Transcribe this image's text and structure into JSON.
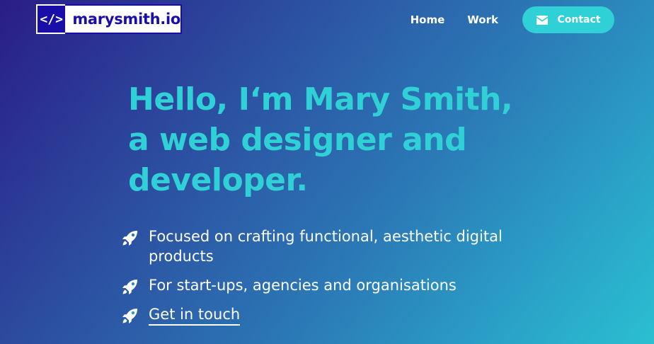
{
  "header": {
    "logo": {
      "code_glyph": "</>",
      "name": "marysmith.io"
    },
    "nav": {
      "home_label": "Home",
      "work_label": "Work",
      "contact_label": "Contact",
      "contact_icon": "envelope-icon"
    }
  },
  "hero": {
    "title": "Hello, I‘m Mary Smith, a web designer and developer."
  },
  "features": {
    "icon": "rocket-icon",
    "items": [
      {
        "label": "Focused on crafting functional, aesthetic digital products"
      },
      {
        "label": "For start-ups, agencies and organisations"
      },
      {
        "label": "Get in touch"
      }
    ]
  },
  "colors": {
    "accent": "#2fd0d6",
    "logo_blue": "#1a0ea8",
    "gradient_start": "#2a1d86",
    "gradient_end": "#2bbfd1"
  }
}
